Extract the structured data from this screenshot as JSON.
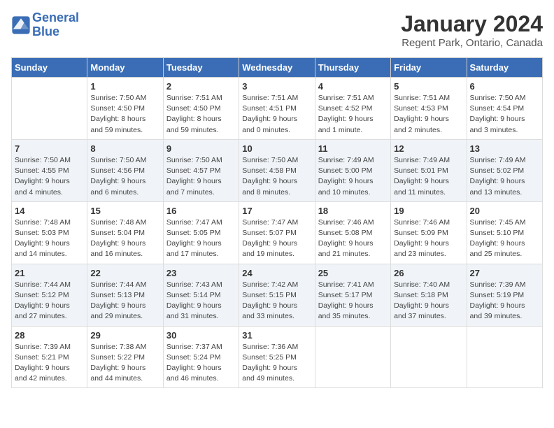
{
  "header": {
    "logo_line1": "General",
    "logo_line2": "Blue",
    "title": "January 2024",
    "subtitle": "Regent Park, Ontario, Canada"
  },
  "columns": [
    "Sunday",
    "Monday",
    "Tuesday",
    "Wednesday",
    "Thursday",
    "Friday",
    "Saturday"
  ],
  "weeks": [
    [
      {
        "day": "",
        "info": ""
      },
      {
        "day": "1",
        "info": "Sunrise: 7:50 AM\nSunset: 4:50 PM\nDaylight: 8 hours\nand 59 minutes."
      },
      {
        "day": "2",
        "info": "Sunrise: 7:51 AM\nSunset: 4:50 PM\nDaylight: 8 hours\nand 59 minutes."
      },
      {
        "day": "3",
        "info": "Sunrise: 7:51 AM\nSunset: 4:51 PM\nDaylight: 9 hours\nand 0 minutes."
      },
      {
        "day": "4",
        "info": "Sunrise: 7:51 AM\nSunset: 4:52 PM\nDaylight: 9 hours\nand 1 minute."
      },
      {
        "day": "5",
        "info": "Sunrise: 7:51 AM\nSunset: 4:53 PM\nDaylight: 9 hours\nand 2 minutes."
      },
      {
        "day": "6",
        "info": "Sunrise: 7:50 AM\nSunset: 4:54 PM\nDaylight: 9 hours\nand 3 minutes."
      }
    ],
    [
      {
        "day": "7",
        "info": "Sunrise: 7:50 AM\nSunset: 4:55 PM\nDaylight: 9 hours\nand 4 minutes."
      },
      {
        "day": "8",
        "info": "Sunrise: 7:50 AM\nSunset: 4:56 PM\nDaylight: 9 hours\nand 6 minutes."
      },
      {
        "day": "9",
        "info": "Sunrise: 7:50 AM\nSunset: 4:57 PM\nDaylight: 9 hours\nand 7 minutes."
      },
      {
        "day": "10",
        "info": "Sunrise: 7:50 AM\nSunset: 4:58 PM\nDaylight: 9 hours\nand 8 minutes."
      },
      {
        "day": "11",
        "info": "Sunrise: 7:49 AM\nSunset: 5:00 PM\nDaylight: 9 hours\nand 10 minutes."
      },
      {
        "day": "12",
        "info": "Sunrise: 7:49 AM\nSunset: 5:01 PM\nDaylight: 9 hours\nand 11 minutes."
      },
      {
        "day": "13",
        "info": "Sunrise: 7:49 AM\nSunset: 5:02 PM\nDaylight: 9 hours\nand 13 minutes."
      }
    ],
    [
      {
        "day": "14",
        "info": "Sunrise: 7:48 AM\nSunset: 5:03 PM\nDaylight: 9 hours\nand 14 minutes."
      },
      {
        "day": "15",
        "info": "Sunrise: 7:48 AM\nSunset: 5:04 PM\nDaylight: 9 hours\nand 16 minutes."
      },
      {
        "day": "16",
        "info": "Sunrise: 7:47 AM\nSunset: 5:05 PM\nDaylight: 9 hours\nand 17 minutes."
      },
      {
        "day": "17",
        "info": "Sunrise: 7:47 AM\nSunset: 5:07 PM\nDaylight: 9 hours\nand 19 minutes."
      },
      {
        "day": "18",
        "info": "Sunrise: 7:46 AM\nSunset: 5:08 PM\nDaylight: 9 hours\nand 21 minutes."
      },
      {
        "day": "19",
        "info": "Sunrise: 7:46 AM\nSunset: 5:09 PM\nDaylight: 9 hours\nand 23 minutes."
      },
      {
        "day": "20",
        "info": "Sunrise: 7:45 AM\nSunset: 5:10 PM\nDaylight: 9 hours\nand 25 minutes."
      }
    ],
    [
      {
        "day": "21",
        "info": "Sunrise: 7:44 AM\nSunset: 5:12 PM\nDaylight: 9 hours\nand 27 minutes."
      },
      {
        "day": "22",
        "info": "Sunrise: 7:44 AM\nSunset: 5:13 PM\nDaylight: 9 hours\nand 29 minutes."
      },
      {
        "day": "23",
        "info": "Sunrise: 7:43 AM\nSunset: 5:14 PM\nDaylight: 9 hours\nand 31 minutes."
      },
      {
        "day": "24",
        "info": "Sunrise: 7:42 AM\nSunset: 5:15 PM\nDaylight: 9 hours\nand 33 minutes."
      },
      {
        "day": "25",
        "info": "Sunrise: 7:41 AM\nSunset: 5:17 PM\nDaylight: 9 hours\nand 35 minutes."
      },
      {
        "day": "26",
        "info": "Sunrise: 7:40 AM\nSunset: 5:18 PM\nDaylight: 9 hours\nand 37 minutes."
      },
      {
        "day": "27",
        "info": "Sunrise: 7:39 AM\nSunset: 5:19 PM\nDaylight: 9 hours\nand 39 minutes."
      }
    ],
    [
      {
        "day": "28",
        "info": "Sunrise: 7:39 AM\nSunset: 5:21 PM\nDaylight: 9 hours\nand 42 minutes."
      },
      {
        "day": "29",
        "info": "Sunrise: 7:38 AM\nSunset: 5:22 PM\nDaylight: 9 hours\nand 44 minutes."
      },
      {
        "day": "30",
        "info": "Sunrise: 7:37 AM\nSunset: 5:24 PM\nDaylight: 9 hours\nand 46 minutes."
      },
      {
        "day": "31",
        "info": "Sunrise: 7:36 AM\nSunset: 5:25 PM\nDaylight: 9 hours\nand 49 minutes."
      },
      {
        "day": "",
        "info": ""
      },
      {
        "day": "",
        "info": ""
      },
      {
        "day": "",
        "info": ""
      }
    ]
  ]
}
